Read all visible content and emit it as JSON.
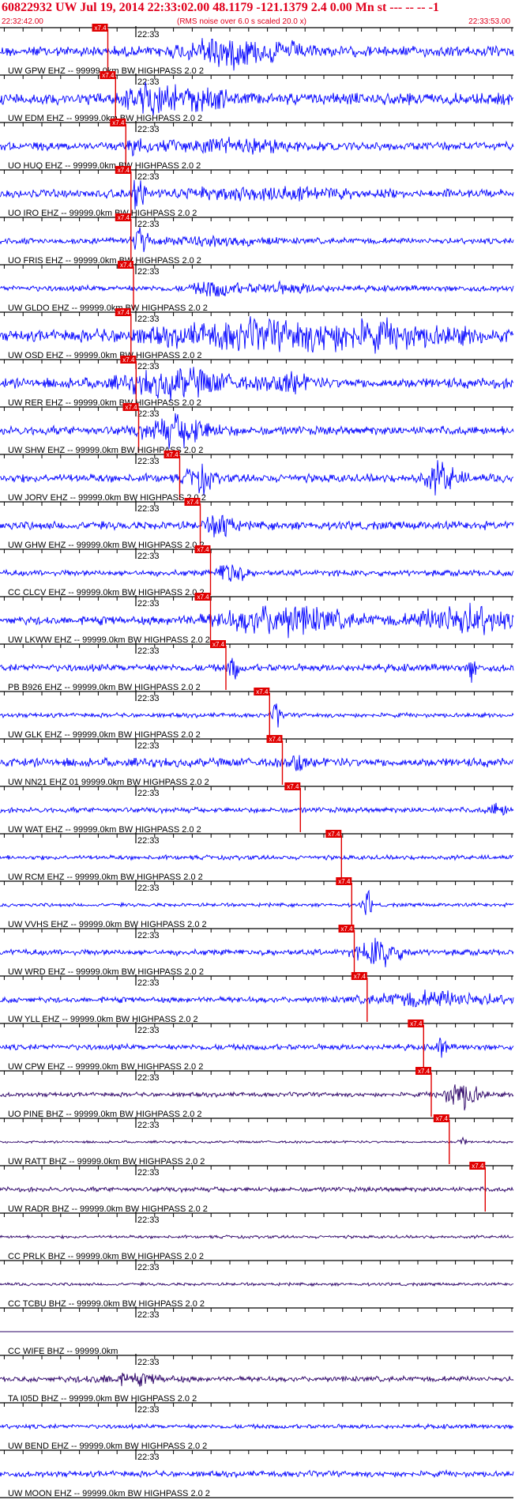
{
  "header": {
    "title": "60822932 UW Jul 19, 2014 22:33:02.00   48.1179 -121.1379  2.4 0.00 Mn st --- -- --   -1",
    "start_time": "22:32:42.00",
    "rms_note": "(RMS noise over 6.0 s scaled 20.0 x)",
    "end_time": "22:33:53.00"
  },
  "colors": {
    "header": "#e0001c",
    "trace_blue": "#0000ff",
    "trace_purple": "#2a0066",
    "pick": "#e00000",
    "axis": "#000000"
  },
  "time_tick_label": "22:33",
  "pick_label": "x7.4",
  "traces": [
    {
      "label": "UW GPW EHZ -- 99999.0km BW  HIGHPASS  2.0  2",
      "color": "blue",
      "pick": 0.21,
      "amp": 0.35,
      "events": [
        [
          0.43,
          0.18,
          0.9
        ],
        [
          0.55,
          0.15,
          0.4
        ]
      ]
    },
    {
      "label": "UW EDM EHZ -- 99999.0km BW  HIGHPASS  2.0  2",
      "color": "blue",
      "pick": 0.225,
      "amp": 0.4,
      "events": [
        [
          0.3,
          0.12,
          1.0
        ],
        [
          0.4,
          0.1,
          0.6
        ]
      ]
    },
    {
      "label": "UO HUQ EHZ -- 99999.0km BW  HIGHPASS  2.0  2",
      "color": "blue",
      "pick": 0.245,
      "amp": 0.28,
      "events": [
        [
          0.27,
          0.04,
          1.0
        ],
        [
          0.45,
          0.3,
          0.35
        ]
      ]
    },
    {
      "label": "UO IRO EHZ -- 99999.0km BW  HIGHPASS  2.0  2",
      "color": "blue",
      "pick": 0.255,
      "amp": 0.28,
      "events": [
        [
          0.27,
          0.03,
          1.0
        ],
        [
          0.5,
          0.4,
          0.3
        ]
      ]
    },
    {
      "label": "UO FRIS EHZ -- 99999.0km BW  HIGHPASS  2.0  2",
      "color": "blue",
      "pick": 0.255,
      "amp": 0.2,
      "events": [
        [
          0.275,
          0.03,
          1.0
        ],
        [
          0.4,
          0.3,
          0.2
        ]
      ]
    },
    {
      "label": "UW GLDO EHZ -- 99999.0km BW  HIGHPASS  2.0  2",
      "color": "blue",
      "pick": 0.26,
      "amp": 0.2,
      "events": [
        [
          0.42,
          0.1,
          0.5
        ],
        [
          0.55,
          0.2,
          0.25
        ]
      ]
    },
    {
      "label": "UW OSD EHZ -- 99999.0km BW  HIGHPASS  2.0  2",
      "color": "blue",
      "pick": 0.255,
      "amp": 0.35,
      "events": [
        [
          0.6,
          0.7,
          1.0
        ]
      ]
    },
    {
      "label": "UW RER EHZ -- 99999.0km BW  HIGHPASS  2.0  2",
      "color": "blue",
      "pick": 0.265,
      "amp": 0.35,
      "events": [
        [
          0.35,
          0.25,
          0.8
        ],
        [
          0.56,
          0.1,
          0.5
        ]
      ]
    },
    {
      "label": "UW SHW EHZ -- 99999.0km BW  HIGHPASS  2.0  2",
      "color": "blue",
      "pick": 0.27,
      "amp": 0.3,
      "events": [
        [
          0.35,
          0.15,
          1.0
        ]
      ]
    },
    {
      "label": "UW JORV EHZ -- 99999.0km BW  HIGHPASS  2.0  2",
      "color": "blue",
      "pick": 0.35,
      "amp": 0.28,
      "events": [
        [
          0.39,
          0.06,
          0.9
        ],
        [
          0.86,
          0.08,
          0.95
        ]
      ]
    },
    {
      "label": "UW GHW EHZ -- 99999.0km BW  HIGHPASS  2.0  2",
      "color": "blue",
      "pick": 0.39,
      "amp": 0.28,
      "events": [
        [
          0.43,
          0.06,
          0.8
        ]
      ]
    },
    {
      "label": "CC CLCV EHZ -- 99999.0km BW  HIGHPASS  2.0  2",
      "color": "blue",
      "pick": 0.41,
      "amp": 0.2,
      "events": [
        [
          0.45,
          0.06,
          0.8
        ]
      ]
    },
    {
      "label": "UW LKWW EHZ -- 99999.0km BW  HIGHPASS  2.0  2",
      "color": "blue",
      "pick": 0.41,
      "amp": 0.3,
      "events": [
        [
          0.55,
          0.3,
          0.9
        ],
        [
          0.9,
          0.2,
          1.0
        ]
      ]
    },
    {
      "label": "PB B926 EHZ -- 99999.0km BW  HIGHPASS  2.0  2",
      "color": "blue",
      "pick": 0.44,
      "amp": 0.25,
      "events": [
        [
          0.455,
          0.02,
          1.0
        ],
        [
          0.92,
          0.015,
          1.0
        ]
      ]
    },
    {
      "label": "UW GLK EHZ -- 99999.0km BW  HIGHPASS  2.0  2",
      "color": "blue",
      "pick": 0.525,
      "amp": 0.15,
      "events": [
        [
          0.54,
          0.02,
          0.9
        ]
      ]
    },
    {
      "label": "UW NN21 EHZ 01 99999.0km BW  HIGHPASS  2.0  2",
      "color": "blue",
      "pick": 0.55,
      "amp": 0.3,
      "events": [
        [
          0.58,
          0.03,
          0.7
        ]
      ]
    },
    {
      "label": "UW WAT EHZ -- 99999.0km BW  HIGHPASS  2.0  2",
      "color": "blue",
      "pick": 0.585,
      "amp": 0.18,
      "events": [
        [
          0.97,
          0.05,
          0.4
        ]
      ]
    },
    {
      "label": "UW RCM EHZ -- 99999.0km BW  HIGHPASS  2.0  2",
      "color": "blue",
      "pick": 0.665,
      "amp": 0.15,
      "events": []
    },
    {
      "label": "UW VVHS EHZ -- 99999.0km BW  HIGHPASS  2.0  2",
      "color": "blue",
      "pick": 0.685,
      "amp": 0.12,
      "events": [
        [
          0.715,
          0.02,
          1.0
        ]
      ]
    },
    {
      "label": "UW WRD EHZ -- 99999.0km BW  HIGHPASS  2.0  2",
      "color": "blue",
      "pick": 0.69,
      "amp": 0.2,
      "events": [
        [
          0.74,
          0.1,
          0.9
        ]
      ]
    },
    {
      "label": "UW YLL EHZ -- 99999.0km BW  HIGHPASS  2.0  2",
      "color": "blue",
      "pick": 0.715,
      "amp": 0.2,
      "events": [
        [
          0.85,
          0.3,
          0.45
        ]
      ]
    },
    {
      "label": "UW CPW EHZ -- 99999.0km BW  HIGHPASS  2.0  2",
      "color": "blue",
      "pick": 0.825,
      "amp": 0.2,
      "events": [
        [
          0.86,
          0.02,
          0.8
        ]
      ]
    },
    {
      "label": "UO PINE BHZ -- 99999.0km BW  HIGHPASS  2.0  2",
      "color": "purple",
      "pick": 0.84,
      "amp": 0.15,
      "events": [
        [
          0.9,
          0.08,
          1.0
        ]
      ]
    },
    {
      "label": "UW RATT BHZ -- 99999.0km BW  HIGHPASS  2.0  2",
      "color": "purple",
      "pick": 0.875,
      "amp": 0.08,
      "events": [
        [
          0.9,
          0.02,
          0.3
        ]
      ]
    },
    {
      "label": "UW RADR BHZ -- 99999.0km BW  HIGHPASS  2.0  2",
      "color": "purple",
      "pick": 0.945,
      "amp": 0.16,
      "events": []
    },
    {
      "label": "CC PRLK BHZ -- 99999.0km BW  HIGHPASS  2.0  2",
      "color": "purple",
      "pick": null,
      "amp": 0.1,
      "events": []
    },
    {
      "label": "CC TCBU BHZ -- 99999.0km BW  HIGHPASS  2.0  2",
      "color": "purple",
      "pick": null,
      "amp": 0.1,
      "events": []
    },
    {
      "label": "CC WIFE BHZ -- 99999.0km",
      "color": "purple",
      "pick": null,
      "amp": 0.0,
      "events": []
    },
    {
      "label": "TA I05D BHZ -- 99999.0km BW  HIGHPASS  2.0  2",
      "color": "purple",
      "pick": null,
      "amp": 0.18,
      "events": [
        [
          0.25,
          0.2,
          0.3
        ]
      ]
    },
    {
      "label": "UW BEND EHZ -- 99999.0km BW  HIGHPASS  2.0  2",
      "color": "blue",
      "pick": null,
      "amp": 0.15,
      "events": []
    },
    {
      "label": "UW MOON EHZ -- 99999.0km BW  HIGHPASS  2.0  2",
      "color": "blue",
      "pick": null,
      "amp": 0.2,
      "events": []
    }
  ]
}
